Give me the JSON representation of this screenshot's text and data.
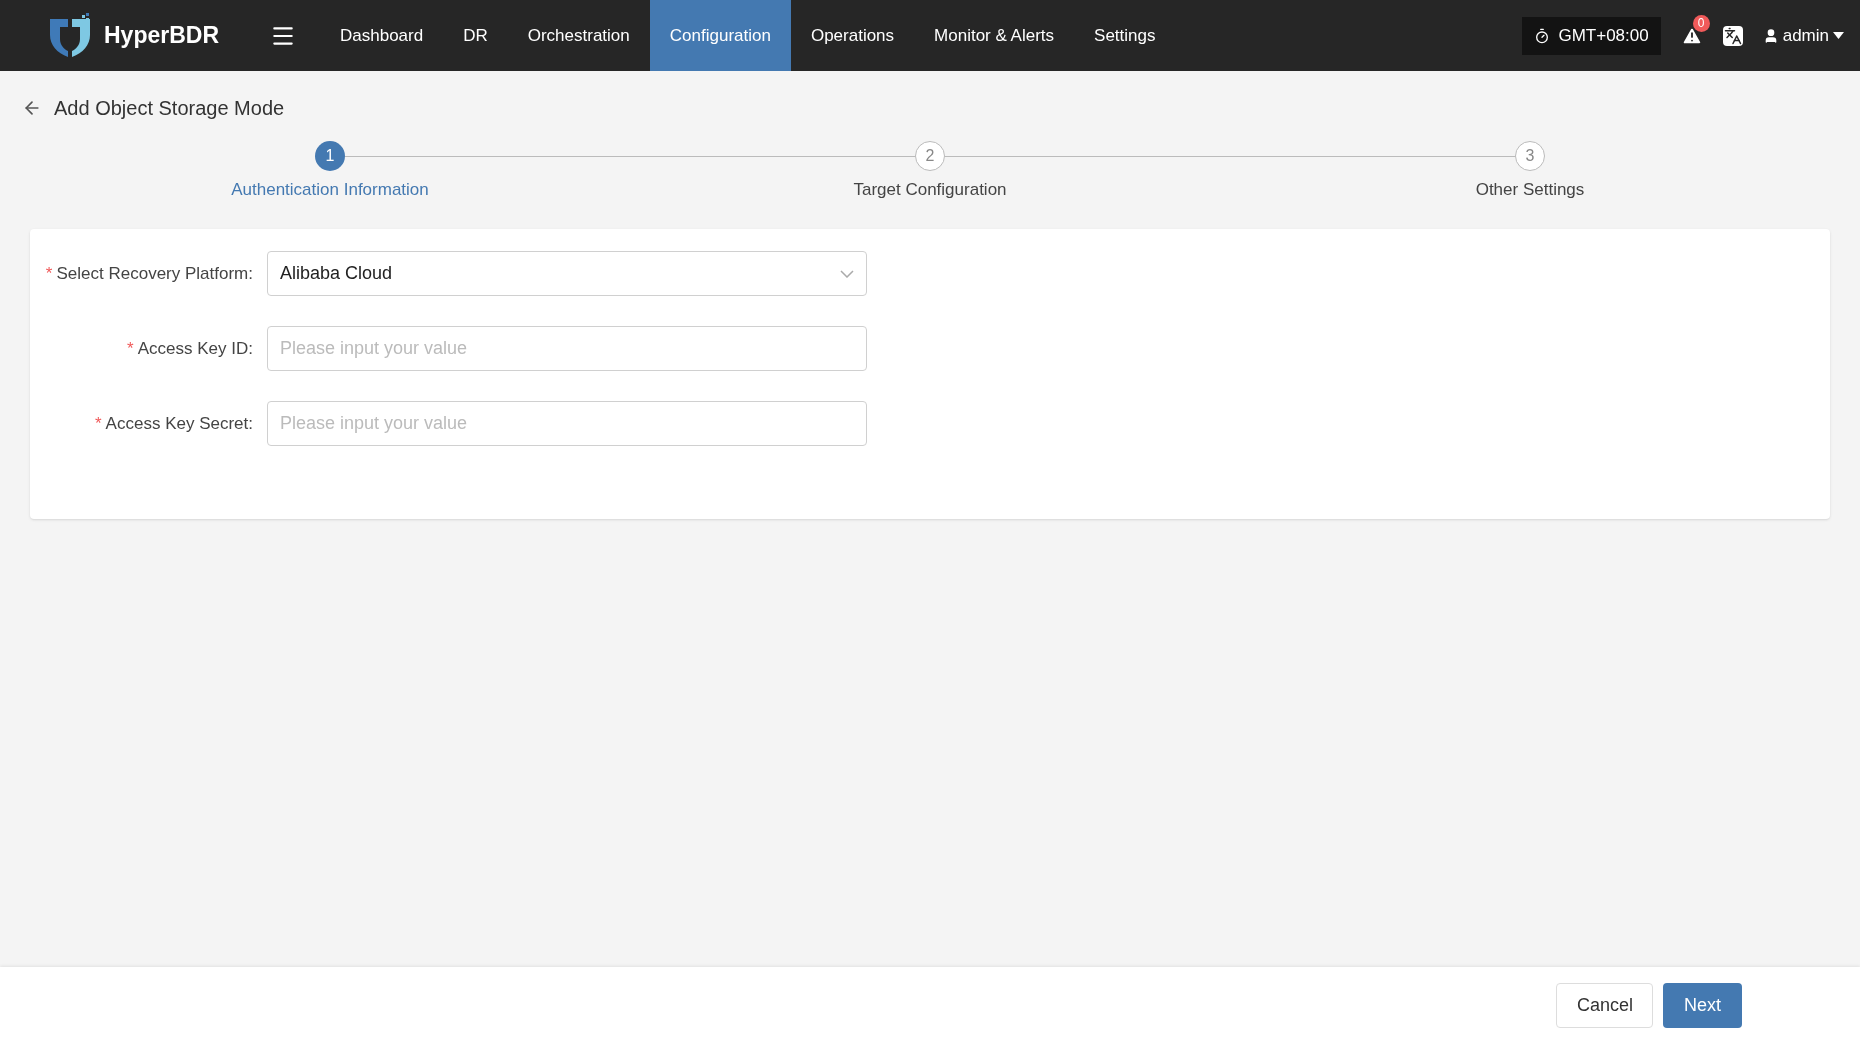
{
  "header": {
    "brand": "HyperBDR",
    "nav": [
      {
        "label": "Dashboard",
        "selected": false
      },
      {
        "label": "DR",
        "selected": false
      },
      {
        "label": "Orchestration",
        "selected": false
      },
      {
        "label": "Configuration",
        "selected": true
      },
      {
        "label": "Operations",
        "selected": false
      },
      {
        "label": "Monitor & Alerts",
        "selected": false
      },
      {
        "label": "Settings",
        "selected": false
      }
    ],
    "timezone": "GMT+08:00",
    "alert_count": "0",
    "user": "admin"
  },
  "page_title": "Add Object Storage Mode",
  "required_marker": "*",
  "steps": [
    {
      "number": "1",
      "label": "Authentication Information",
      "selected": true
    },
    {
      "number": "2",
      "label": "Target Configuration",
      "selected": false
    },
    {
      "number": "3",
      "label": "Other Settings",
      "selected": false
    }
  ],
  "form": [
    {
      "kind": "select",
      "label": "Select Recovery Platform:",
      "required": true,
      "value": "Alibaba Cloud"
    },
    {
      "kind": "input",
      "label": "Access Key ID:",
      "required": true,
      "placeholder": "Please input your value"
    },
    {
      "kind": "input",
      "label": "Access Key Secret:",
      "required": true,
      "placeholder": "Please input your value"
    }
  ],
  "footer": {
    "buttons": [
      {
        "label": "Cancel",
        "kind": "secondary"
      },
      {
        "label": "Next",
        "kind": "primary"
      }
    ]
  }
}
